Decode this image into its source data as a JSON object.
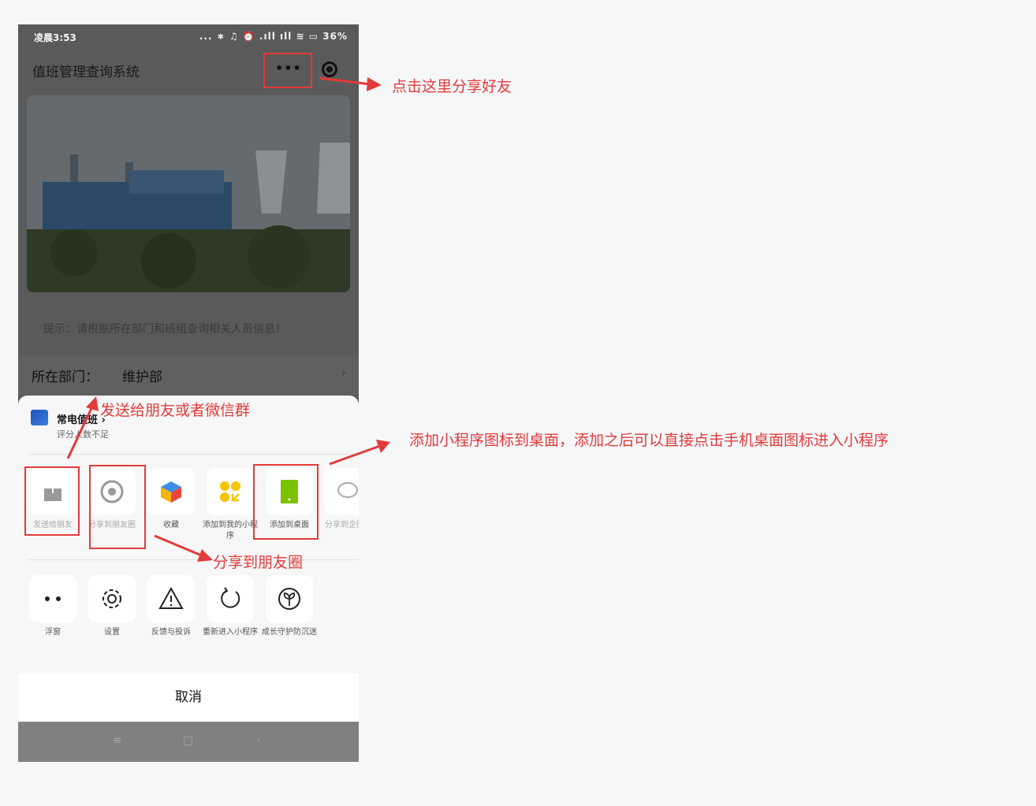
{
  "status": {
    "time": "凌晨3:53",
    "icons": "... ∗ ♫ ⏰ .ıll ıll ≋ ▭ 36%"
  },
  "nav": {
    "title": "值班管理查询系统",
    "more": "•••"
  },
  "hint": "提示：请根据所在部门和班组查询相关人员信息！",
  "department": {
    "label": "所在部门：",
    "value": "维护部",
    "chevron": "›"
  },
  "sheet": {
    "app_name": "常电值班 ›",
    "app_sub": "评分人数不足",
    "row1": [
      {
        "label": "发送给朋友",
        "icon": "share-icon"
      },
      {
        "label": "分享到朋友圈",
        "icon": "moments-icon"
      },
      {
        "label": "收藏",
        "icon": "favorite-cube-icon"
      },
      {
        "label": "添加到我的小程序",
        "icon": "mini-program-icon"
      },
      {
        "label": "添加到桌面",
        "icon": "phone-desktop-icon"
      },
      {
        "label": "分享到企微信",
        "icon": "wecom-icon"
      }
    ],
    "row2": [
      {
        "label": "浮窗",
        "icon": "float-window-icon"
      },
      {
        "label": "设置",
        "icon": "gear-icon"
      },
      {
        "label": "反馈与投诉",
        "icon": "warning-icon"
      },
      {
        "label": "重新进入小程序",
        "icon": "refresh-icon"
      },
      {
        "label": "成长守护防沉迷",
        "icon": "sprout-icon"
      }
    ],
    "cancel": "取消"
  },
  "system_nav": {
    "menu": "≡",
    "home": "□",
    "back": "‹"
  },
  "annotations": {
    "share_friend": "点击这里分享好友",
    "send_friend": "发送给朋友或者微信群",
    "desktop": "添加小程序图标到桌面，添加之后可以直接点击手机桌面图标进入小程序",
    "moments": "分享到朋友圈"
  },
  "colors": {
    "annotation_red": "#e23b3b",
    "desktop_icon_green": "#7bc300",
    "logo_blue": "#1d4fb8"
  }
}
